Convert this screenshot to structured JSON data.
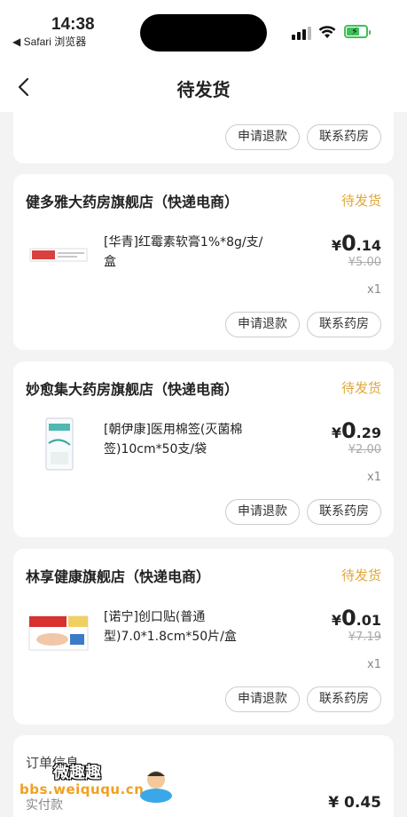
{
  "status_bar": {
    "time": "14:38",
    "back_app": "◀ Safari 浏览器"
  },
  "nav": {
    "title": "待发货",
    "back_icon": "chevron-left-icon"
  },
  "actions": {
    "refund": "申请退款",
    "contact": "联系药房"
  },
  "orders": [
    {
      "shop": "健多雅大药房旗舰店（快递电商）",
      "status": "待发货",
      "product": "[华青]红霉素软膏1%*8g/支/盒",
      "price_yen": "¥",
      "price_int": "0",
      "price_dec": ".14",
      "original_price": "¥5.00",
      "qty": "x1"
    },
    {
      "shop": "妙愈集大药房旗舰店（快递电商）",
      "status": "待发货",
      "product": "[朝伊康]医用棉签(灭菌棉签)10cm*50支/袋",
      "price_yen": "¥",
      "price_int": "0",
      "price_dec": ".29",
      "original_price": "¥2.00",
      "qty": "x1"
    },
    {
      "shop": "林享健康旗舰店（快递电商）",
      "status": "待发货",
      "product": "[诺宁]创口贴(普通型)7.0*1.8cm*50片/盒",
      "price_yen": "¥",
      "price_int": "0",
      "price_dec": ".01",
      "original_price": "¥7.19",
      "qty": "x1"
    }
  ],
  "order_info": {
    "title": "订单信息",
    "paid_label": "实付款",
    "paid_value": "¥ 0.45"
  },
  "watermark": {
    "line1": "微趣趣",
    "line2": "bbs.weiququ.cn"
  },
  "colors": {
    "status": "#e0a83a",
    "background": "#f3f3f3",
    "battery": "#3fc05a"
  }
}
